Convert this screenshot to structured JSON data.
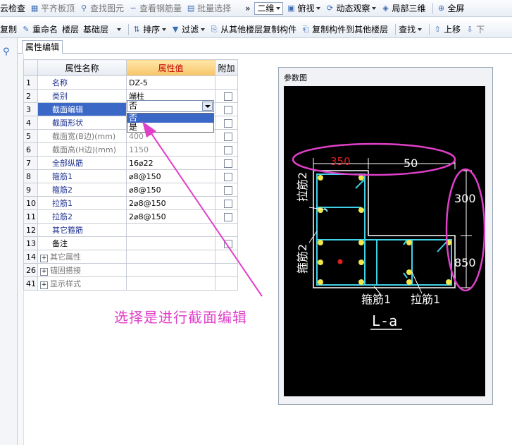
{
  "toolbar1": {
    "items": [
      "云检查",
      "平齐板顶",
      "查找图元",
      "查看钢筋量",
      "批量选择"
    ],
    "more": "»",
    "view_combo": "二维",
    "view_items": [
      "俯视",
      "动态观察",
      "局部三维",
      "全屏"
    ]
  },
  "toolbar2": {
    "items": [
      "复制",
      "重命名",
      "楼层",
      "基础层",
      "排序",
      "过滤",
      "从其他楼层复制构件",
      "复制构件到其他楼层",
      "查找",
      "上移",
      "下"
    ]
  },
  "tab": {
    "label": "属性编辑"
  },
  "grid": {
    "headers": {
      "name": "属性名称",
      "value": "属性值",
      "extra": "附加"
    },
    "rows": [
      {
        "n": "1",
        "name": "名称",
        "value": "DZ-5"
      },
      {
        "n": "2",
        "name": "类别",
        "value": "端柱"
      },
      {
        "n": "3",
        "name": "截面编辑",
        "value": "否"
      },
      {
        "n": "4",
        "name": "截面形状",
        "value": ""
      },
      {
        "n": "5",
        "name": "截面宽(B边)(mm)",
        "value": "400"
      },
      {
        "n": "6",
        "name": "截面高(H边)(mm)",
        "value": "1150"
      },
      {
        "n": "7",
        "name": "全部纵筋",
        "value": "16⌀22"
      },
      {
        "n": "8",
        "name": "箍筋1",
        "value": "⌀8@150"
      },
      {
        "n": "9",
        "name": "箍筋2",
        "value": "⌀8@150"
      },
      {
        "n": "10",
        "name": "拉筋1",
        "value": "2⌀8@150"
      },
      {
        "n": "11",
        "name": "拉筋2",
        "value": "2⌀8@150"
      },
      {
        "n": "12",
        "name": "其它箍筋",
        "value": ""
      },
      {
        "n": "13",
        "name": "备注",
        "value": ""
      },
      {
        "n": "14",
        "name": "其它属性",
        "value": ""
      },
      {
        "n": "26",
        "name": "锚固搭接",
        "value": ""
      },
      {
        "n": "41",
        "name": "显示样式",
        "value": ""
      }
    ]
  },
  "dropdown": {
    "options": [
      "否",
      "是"
    ]
  },
  "hint": "选择是进行截面编辑",
  "panel": {
    "title": "参数图",
    "dims": {
      "d350": "350",
      "d50": "50",
      "d300": "300",
      "d850": "850"
    },
    "labels": {
      "lajin2": "拉筋2",
      "gujin2": "箍筋2",
      "gujin1": "箍筋1",
      "lajin1": "拉筋1",
      "section": "L-a"
    }
  },
  "colors": {
    "accent": "#e040c8",
    "rebar": "#3fd2e8",
    "dot": "#f2e64a",
    "redlabel": "#e02020"
  }
}
